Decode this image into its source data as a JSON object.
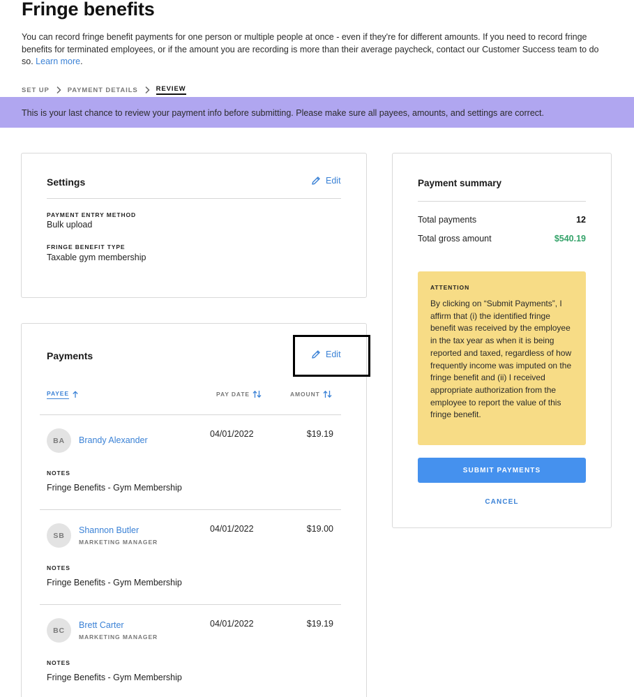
{
  "page": {
    "title": "Fringe benefits",
    "intro": "You can record fringe benefit payments for one person or multiple people at once - even if they're for different amounts. If you need to record fringe benefits for terminated employees, or if the amount you are recording is more than their average paycheck, contact our Customer Success team to do so.",
    "learn_more": "Learn more",
    "intro_end": "."
  },
  "steps": [
    {
      "label": "Set up"
    },
    {
      "label": "Payment details"
    },
    {
      "label": "Review"
    }
  ],
  "banner": "This is your last chance to review your payment info before submitting. Please make sure all payees, amounts, and settings are correct.",
  "settings": {
    "title": "Settings",
    "edit_label": "Edit",
    "fields": [
      {
        "label": "Payment entry method",
        "value": "Bulk upload"
      },
      {
        "label": "Fringe benefit type",
        "value": "Taxable gym membership"
      }
    ]
  },
  "payments": {
    "title": "Payments",
    "edit_label": "Edit",
    "columns": {
      "payee": "Payee",
      "pay_date": "Pay date",
      "amount": "Amount"
    },
    "notes_label": "Notes",
    "rows": [
      {
        "initials": "BA",
        "name": "Brandy Alexander",
        "role": "",
        "date": "04/01/2022",
        "amount": "$19.19",
        "notes": "Fringe Benefits - Gym Membership"
      },
      {
        "initials": "SB",
        "name": "Shannon Butler",
        "role": "Marketing Manager",
        "date": "04/01/2022",
        "amount": "$19.00",
        "notes": "Fringe Benefits - Gym Membership"
      },
      {
        "initials": "BC",
        "name": "Brett Carter",
        "role": "Marketing Manager",
        "date": "04/01/2022",
        "amount": "$19.19",
        "notes": "Fringe Benefits - Gym Membership"
      }
    ]
  },
  "summary": {
    "title": "Payment summary",
    "total_payments_label": "Total payments",
    "total_payments_value": "12",
    "total_gross_label": "Total gross amount",
    "total_gross_value": "$540.19",
    "attention_title": "Attention",
    "attention_body": "By clicking on “Submit Payments”, I affirm that (i) the identified fringe benefit was received by the employee in the tax year as when it is being reported and taxed, regardless of how frequently income was imputed on the fringe benefit and (ii) I received appropriate authorization from the employee to report the value of this fringe benefit.",
    "submit_label": "Submit payments",
    "cancel_label": "Cancel"
  },
  "colors": {
    "accent": "#3b82d6",
    "banner": "#b0a6f0",
    "attention": "#f7dc86",
    "positive": "#35a36a",
    "submit": "#4591ee"
  }
}
